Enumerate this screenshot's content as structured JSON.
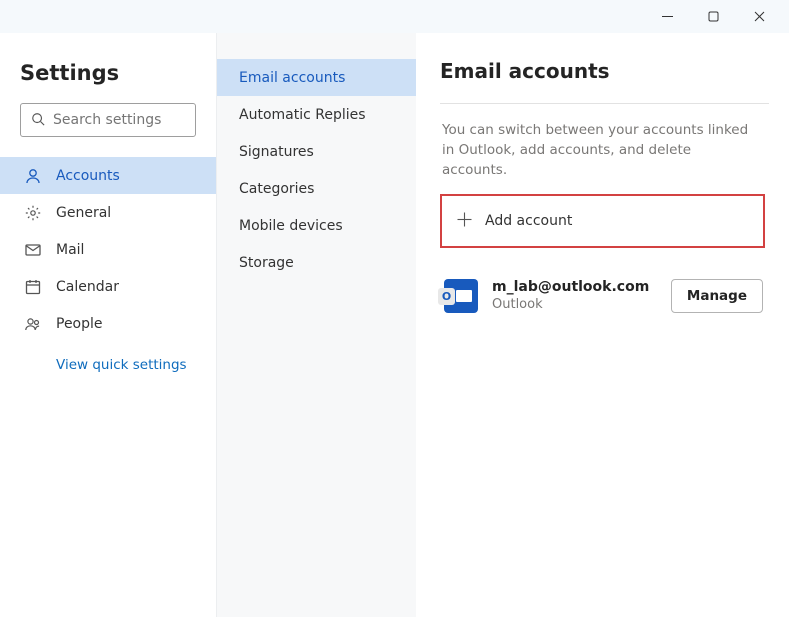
{
  "window": {
    "title": "Settings"
  },
  "search": {
    "placeholder": "Search settings"
  },
  "primary_nav": {
    "items": [
      {
        "label": "Accounts",
        "icon": "person-icon",
        "selected": true
      },
      {
        "label": "General",
        "icon": "gear-icon"
      },
      {
        "label": "Mail",
        "icon": "mail-icon"
      },
      {
        "label": "Calendar",
        "icon": "calendar-icon"
      },
      {
        "label": "People",
        "icon": "people-icon"
      }
    ],
    "quick_link": "View quick settings"
  },
  "secondary_nav": {
    "items": [
      {
        "label": "Email accounts",
        "selected": true
      },
      {
        "label": "Automatic Replies"
      },
      {
        "label": "Signatures"
      },
      {
        "label": "Categories"
      },
      {
        "label": "Mobile devices"
      },
      {
        "label": "Storage"
      }
    ]
  },
  "detail": {
    "heading": "Email accounts",
    "description": "You can switch between your accounts linked in Outlook, add accounts, and delete accounts.",
    "add_account_label": "Add account",
    "accounts": [
      {
        "email": "m_lab@outlook.com",
        "type": "Outlook",
        "manage_label": "Manage"
      }
    ]
  }
}
